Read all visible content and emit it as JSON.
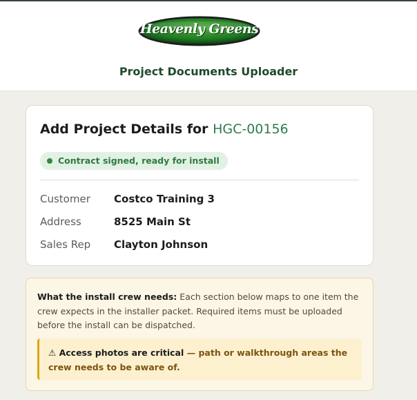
{
  "header": {
    "logo_text": "Heavenly Greens",
    "app_title": "Project Documents Uploader"
  },
  "project": {
    "title_prefix": "Add Project Details for",
    "project_id": "HGC-00156",
    "status": "Contract signed, ready for install",
    "details": {
      "customer_label": "Customer",
      "customer_value": "Costco Training 3",
      "address_label": "Address",
      "address_value": "8525 Main St",
      "sales_rep_label": "Sales Rep",
      "sales_rep_value": "Clayton Johnson"
    }
  },
  "info": {
    "lead": "What the install crew needs:",
    "body": "Each section below maps to one item the crew expects in the installer packet. Required items must be uploaded before the install can be dispatched.",
    "alert_icon": "⚠",
    "alert_strong": "Access photos are critical",
    "alert_rest": "— path or walkthrough areas the crew needs to be aware of."
  },
  "colors": {
    "brand_green": "#2f7a4f",
    "status_green": "#2d7a3f",
    "warning_amber": "#e0a515"
  }
}
